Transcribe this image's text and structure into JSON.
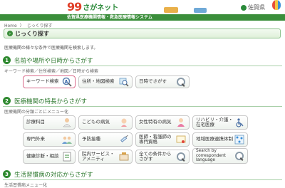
{
  "header": {
    "logo_number": "99",
    "logo_text": "さがネット",
    "subtitle": "佐賀県医療機関情報・救急医療情報システム",
    "region_label": "佐賀県"
  },
  "breadcrumb": {
    "home": "Home",
    "separator": "〉",
    "current": "じっくり探す"
  },
  "page_title": "じっくり探す",
  "intro": "医療機関の様々な条件で医療機関を検索します。",
  "sections": [
    {
      "num": "1",
      "title": "名前や場所や日時からさがす",
      "sub": "キーワード検索／住所検索／地図／日時から検索"
    },
    {
      "num": "2",
      "title": "医療機関の特長からさがす",
      "sub": "医療機関の分類ごとにメニュー化"
    },
    {
      "num": "3",
      "title": "生活習慣病の対応からさがす",
      "sub": "生活習慣病メニュー化"
    }
  ],
  "section1_buttons": [
    {
      "label": "キーワード検索",
      "icon": "keyword-a-icon"
    },
    {
      "label": "住所・地図検索",
      "icon": "map-search-icon"
    },
    {
      "label": "日時でさがす",
      "icon": "magnifier-icon"
    }
  ],
  "section2_buttons": [
    {
      "label": "診療科目",
      "icon": "doctor-icon"
    },
    {
      "label": "こどもの病気",
      "icon": "child-icon"
    },
    {
      "label": "女性特有の病気",
      "icon": "woman-icon"
    },
    {
      "label": "リハビリ・介護・在宅医療",
      "icon": "wheelchair-icon"
    },
    {
      "label": "専門外来",
      "icon": "doctor-group-icon"
    },
    {
      "label": "予防接種",
      "icon": "syringe-icon"
    },
    {
      "label": "医師・看護師の専門資格",
      "icon": "certificate-icon"
    },
    {
      "label": "地域医療連携体制",
      "icon": "network-icon"
    },
    {
      "label": "健康診断・相談",
      "icon": "checkup-icon"
    },
    {
      "label": "院内サービス・アメニティ",
      "icon": "service-icon"
    },
    {
      "label": "全ての条件からさがす",
      "icon": "all-search-icon"
    },
    {
      "label": "Search by correspondent language",
      "icon": "language-icon"
    }
  ],
  "colors": {
    "accent_green": "#2f8a30",
    "active_border": "#d96a8a"
  }
}
